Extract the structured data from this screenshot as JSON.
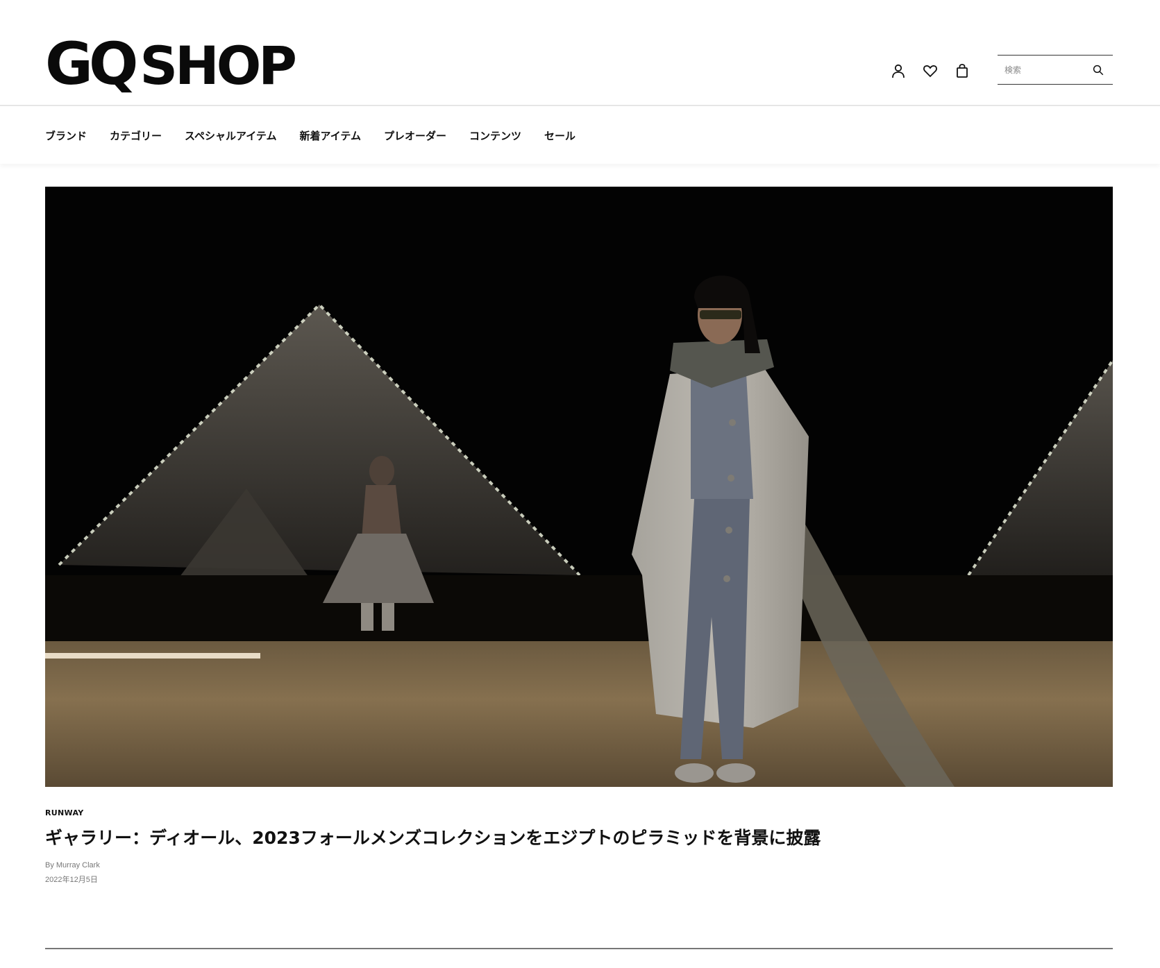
{
  "header": {
    "logo_gq": "GQ",
    "logo_shop": "SHOP",
    "icons": [
      "user-icon",
      "heart-icon",
      "shopping-bag-icon"
    ],
    "search_placeholder": "検索"
  },
  "nav": {
    "items": [
      {
        "label": "ブランド"
      },
      {
        "label": "カテゴリー"
      },
      {
        "label": "スペシャルアイテム"
      },
      {
        "label": "新着アイテム"
      },
      {
        "label": "プレオーダー"
      },
      {
        "label": "コンテンツ"
      },
      {
        "label": "セール"
      }
    ]
  },
  "article": {
    "kicker": "RUNWAY",
    "headline": "ギャラリー：ディオール、2023フォールメンズコレクションをエジプトのピラミッドを背景に披露",
    "byline": "By Murray Clark",
    "date": "2022年12月5日"
  },
  "colors": {
    "text": "#111111",
    "muted": "#777777",
    "border": "#e6e6e6"
  }
}
